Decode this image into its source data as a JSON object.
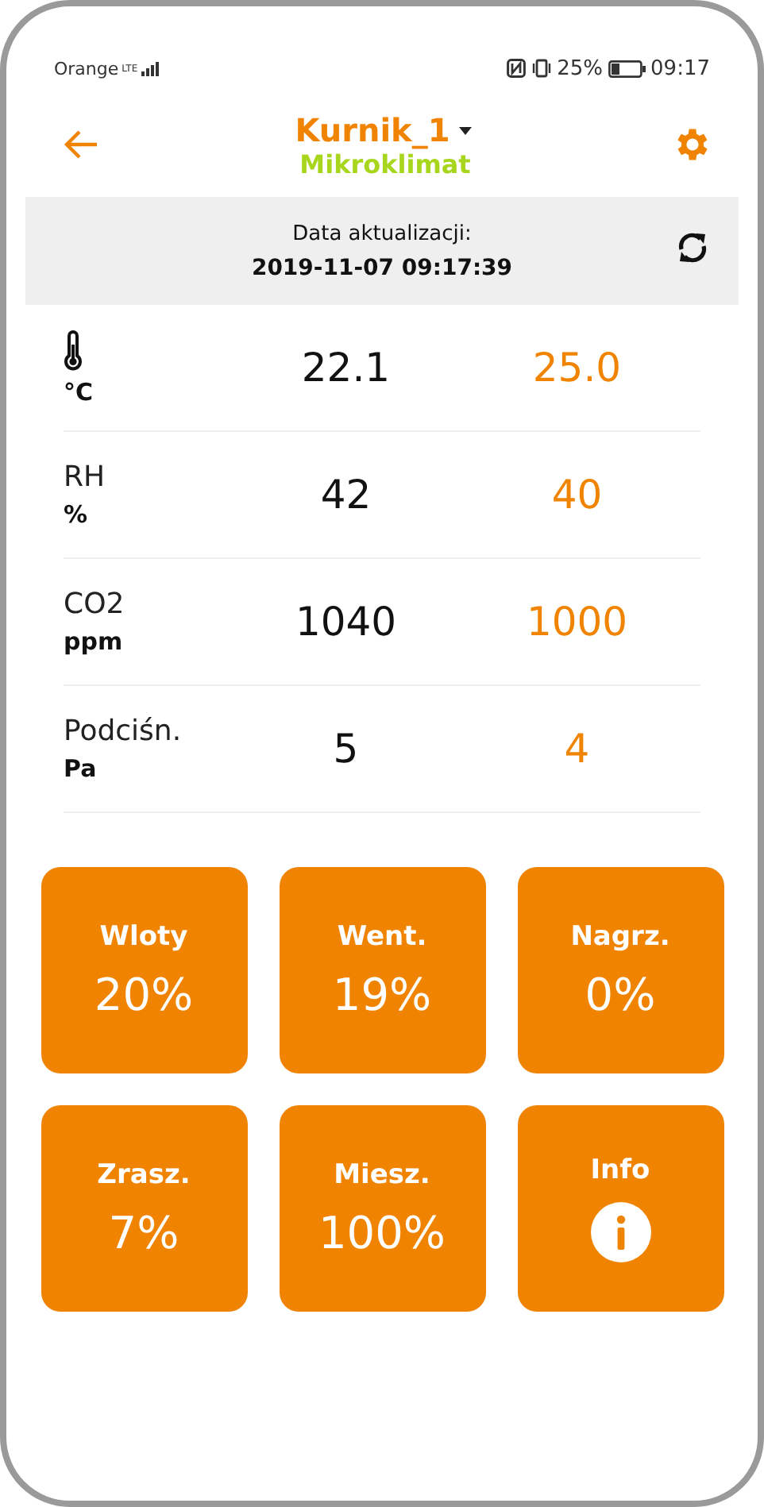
{
  "status_bar": {
    "carrier": "Orange",
    "network": "LTE",
    "battery": "25%",
    "time": "09:17"
  },
  "header": {
    "title": "Kurnik_1",
    "subtitle": "Mikroklimat"
  },
  "update": {
    "label": "Data aktualizacji:",
    "value": "2019-11-07 09:17:39"
  },
  "readings": [
    {
      "kind": "icon",
      "unit": "°C",
      "value": "22.1",
      "setpoint": "25.0"
    },
    {
      "kind": "text",
      "name": "RH",
      "unit": "%",
      "value": "42",
      "setpoint": "40"
    },
    {
      "kind": "text",
      "name": "CO2",
      "unit": "ppm",
      "value": "1040",
      "setpoint": "1000"
    },
    {
      "kind": "text",
      "name": "Podciśn.",
      "unit": "Pa",
      "value": "5",
      "setpoint": "4"
    }
  ],
  "tiles": [
    {
      "kind": "value",
      "label": "Wloty",
      "value": "20%"
    },
    {
      "kind": "value",
      "label": "Went.",
      "value": "19%"
    },
    {
      "kind": "value",
      "label": "Nagrz.",
      "value": "0%"
    },
    {
      "kind": "value",
      "label": "Zrasz.",
      "value": "7%"
    },
    {
      "kind": "value",
      "label": "Miesz.",
      "value": "100%"
    },
    {
      "kind": "info",
      "label": "Info"
    }
  ]
}
